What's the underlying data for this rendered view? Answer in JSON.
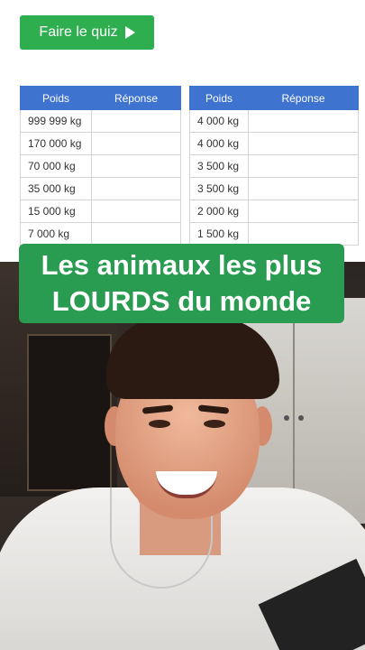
{
  "quiz_button": {
    "label": "Faire le quiz",
    "icon": "play-icon",
    "color": "#2fae4f"
  },
  "table_left": {
    "headers": [
      "Poids",
      "Réponse"
    ],
    "rows": [
      {
        "poids": "999 999 kg",
        "reponse": ""
      },
      {
        "poids": "170 000 kg",
        "reponse": ""
      },
      {
        "poids": "70 000 kg",
        "reponse": ""
      },
      {
        "poids": "35 000 kg",
        "reponse": ""
      },
      {
        "poids": "15 000 kg",
        "reponse": ""
      },
      {
        "poids": "7 000 kg",
        "reponse": ""
      }
    ]
  },
  "table_right": {
    "headers": [
      "Poids",
      "Réponse"
    ],
    "rows": [
      {
        "poids": "4 000 kg",
        "reponse": ""
      },
      {
        "poids": "4 000 kg",
        "reponse": ""
      },
      {
        "poids": "3 500 kg",
        "reponse": ""
      },
      {
        "poids": "3 500 kg",
        "reponse": ""
      },
      {
        "poids": "2 000 kg",
        "reponse": ""
      },
      {
        "poids": "1 500 kg",
        "reponse": ""
      }
    ]
  },
  "header_color": "#3e73d0",
  "overlay": {
    "line1": "Les animaux les plus",
    "line2": "LOURDS du monde",
    "color": "#2a9c52"
  }
}
